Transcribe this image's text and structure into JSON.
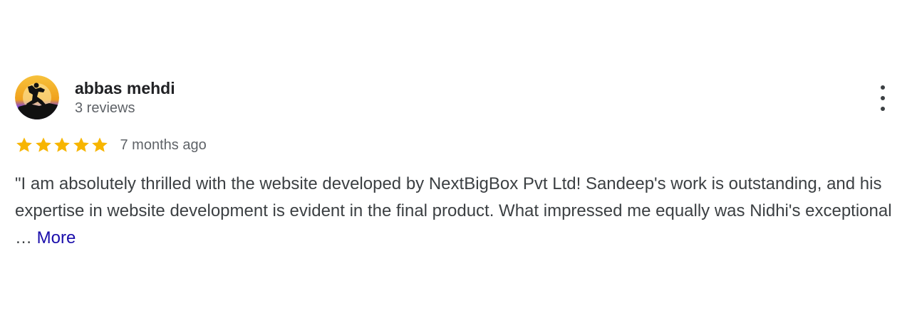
{
  "review": {
    "author_name": "abbas mehdi",
    "author_meta": "3 reviews",
    "rating": 5,
    "rating_max": 5,
    "time": "7 months ago",
    "text": "\"I am absolutely thrilled with the website developed by NextBigBox Pvt Ltd! Sandeep's work is outstanding, and his expertise in website development is evident in the final product. What impressed me equally was Nidhi's exceptional …",
    "more_label": "More",
    "avatar_icon": "avatar-person-silhouette-icon",
    "menu_icon": "more-vertical-icon",
    "star_icon": "star-icon"
  },
  "colors": {
    "star": "#f7b500",
    "link": "#1a0dab",
    "avatar_top": "#f5b324",
    "avatar_bottom": "#6a2bd1"
  }
}
